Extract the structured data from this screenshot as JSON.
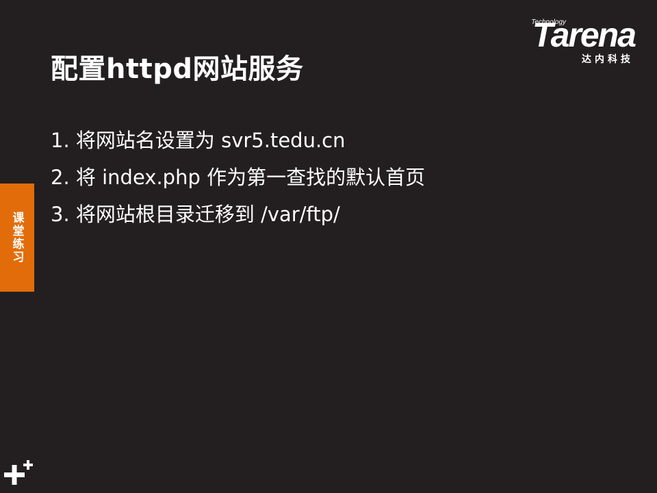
{
  "slide": {
    "title": "配置httpd网站服务",
    "bullets": [
      "1. 将网站名设置为 svr5.tedu.cn",
      "2. 将 index.php 作为第一查找的默认首页",
      "3. 将网站根目录迁移到 /var/ftp/"
    ]
  },
  "logo": {
    "tagline": "Technology",
    "name": "Tarena",
    "cn_name": "达内科技"
  },
  "side_tab": {
    "label": "课堂练习"
  },
  "colors": {
    "background": "#231f20",
    "accent": "#e36c0a",
    "text": "#ffffff"
  },
  "icons": {
    "corner": "plus-icon"
  }
}
